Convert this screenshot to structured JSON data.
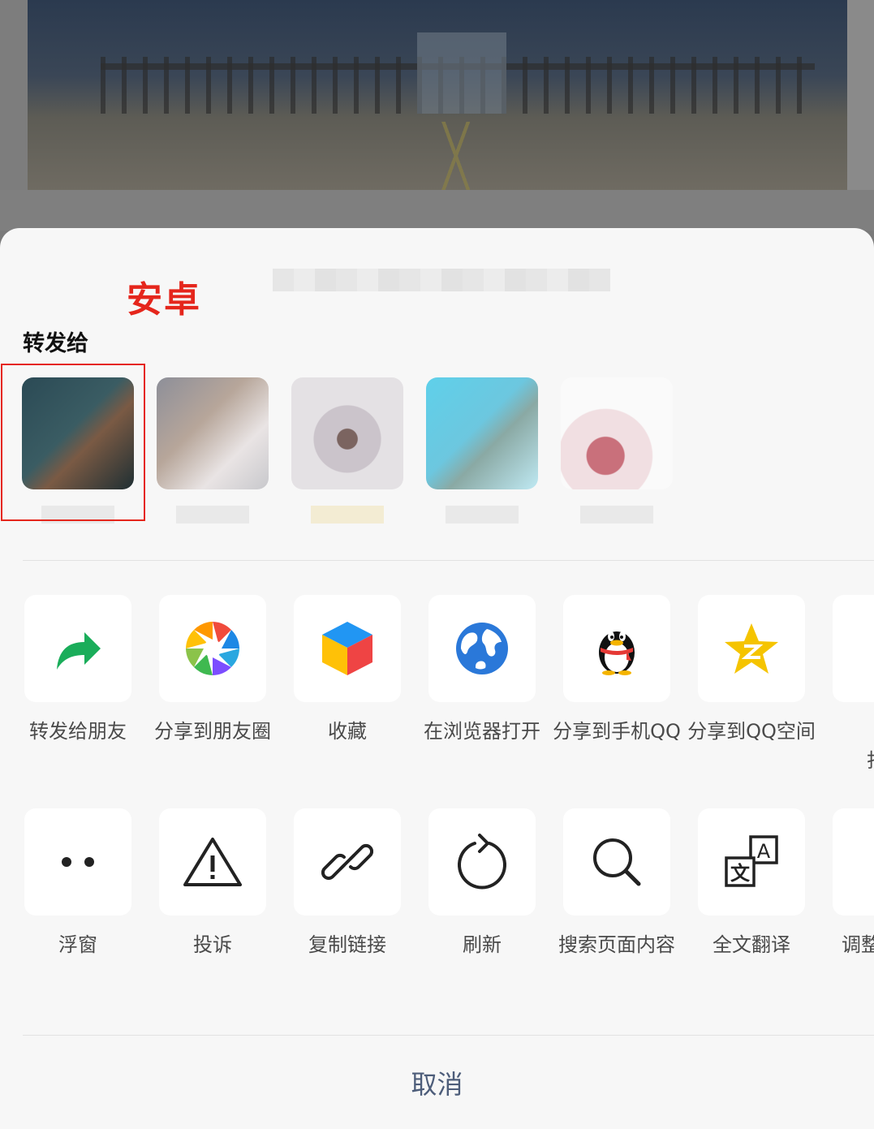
{
  "annotation": {
    "label": "安卓",
    "color": "#e5261c"
  },
  "share_sheet": {
    "forward_title": "转发给",
    "contacts": [
      {
        "avatar": "blurred-avatar"
      },
      {
        "avatar": "blurred-avatar"
      },
      {
        "avatar": "blurred-avatar"
      },
      {
        "avatar": "blurred-avatar"
      },
      {
        "avatar": "blurred-avatar"
      }
    ],
    "row1": [
      {
        "label": "转发给朋友",
        "icon": "forward-arrow-icon",
        "color": "#1aad5a"
      },
      {
        "label": "分享到朋友圈",
        "icon": "moments-aperture-icon"
      },
      {
        "label": "收藏",
        "icon": "favorite-cube-icon"
      },
      {
        "label": "在浏览器打开",
        "icon": "browser-globe-icon",
        "color": "#2a78d9"
      },
      {
        "label": "分享到手机QQ",
        "icon": "qq-penguin-icon"
      },
      {
        "label": "分享到QQ空间",
        "icon": "qzone-star-icon",
        "color": "#f5c400"
      },
      {
        "label": "更\n打开",
        "icon": "more-icon"
      }
    ],
    "row2": [
      {
        "label": "浮窗",
        "icon": "floating-window-icon"
      },
      {
        "label": "投诉",
        "icon": "warning-triangle-icon"
      },
      {
        "label": "复制链接",
        "icon": "link-icon"
      },
      {
        "label": "刷新",
        "icon": "refresh-icon"
      },
      {
        "label": "搜索页面内容",
        "icon": "search-icon"
      },
      {
        "label": "全文翻译",
        "icon": "translate-icon"
      },
      {
        "label": "调整",
        "icon": "font-size-icon"
      }
    ],
    "cancel_label": "取消",
    "cancel_color": "#4d5d7a"
  }
}
